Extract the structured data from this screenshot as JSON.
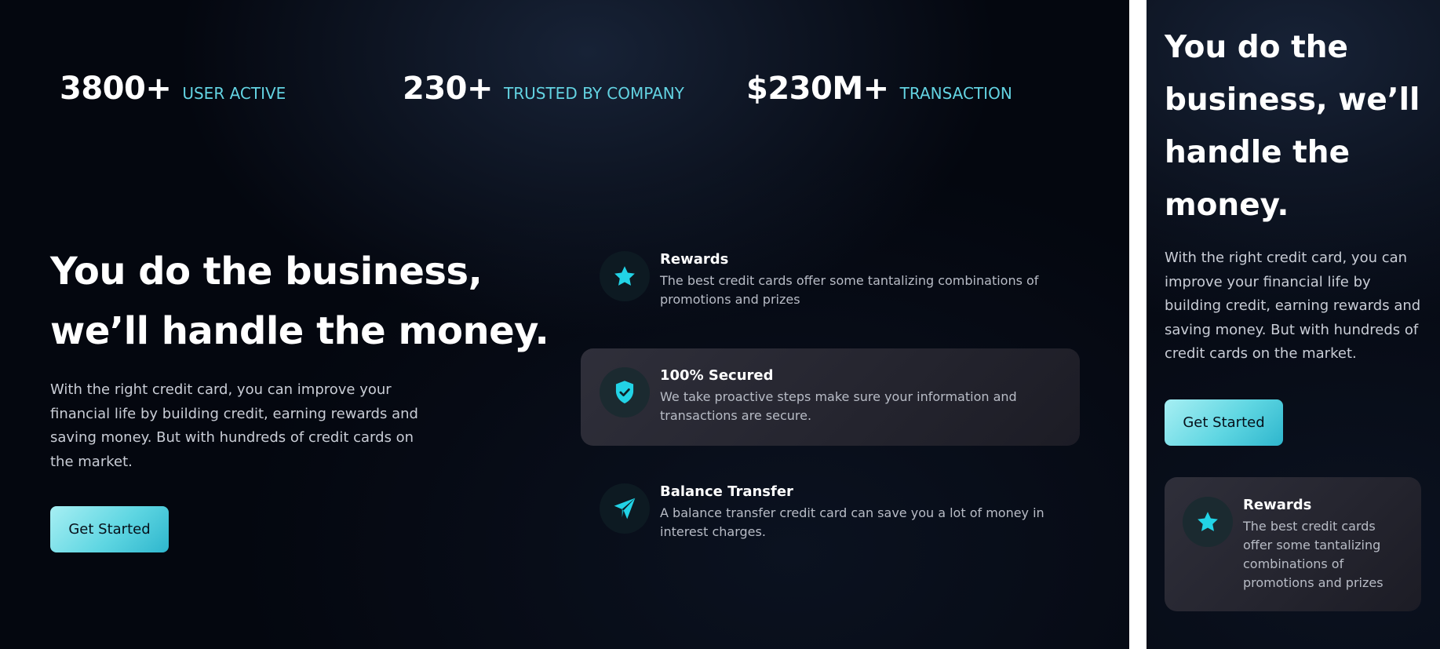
{
  "stats": [
    {
      "value": "3800+",
      "label": "USER ACTIVE"
    },
    {
      "value": "230+",
      "label": "TRUSTED BY COMPANY"
    },
    {
      "value": "$230M+",
      "label": "TRANSACTION"
    }
  ],
  "hero": {
    "title_line1": "You do the business,",
    "title_line2": "we’ll handle the money.",
    "description": "With the right credit card, you can improve your financial life by building credit, earning rewards and saving money. But with hundreds of credit cards on the market.",
    "cta_label": "Get Started"
  },
  "features": [
    {
      "icon": "star-icon",
      "title": "Rewards",
      "text": "The best credit cards offer some tantalizing combinations of promotions and prizes"
    },
    {
      "icon": "shield-check-icon",
      "title": "100% Secured",
      "text": "We take proactive steps make sure your information and transactions are secure."
    },
    {
      "icon": "paper-plane-icon",
      "title": "Balance Transfer",
      "text": "A balance transfer credit card can save you a lot of money in interest charges."
    }
  ],
  "side": {
    "title": "You do the business, we’ll handle the money.",
    "description": "With the right credit card, you can improve your financial life by building credit, earning rewards and saving money. But with hundreds of credit cards on the market.",
    "cta_label": "Get Started",
    "feature": {
      "icon": "star-icon",
      "title": "Rewards",
      "text": "The best credit cards offer some tantalizing combinations of promotions and prizes"
    }
  },
  "colors": {
    "accent": "#22d3e6",
    "stat_label": "#63d3e2",
    "background": "#04070f",
    "card": "#2a2a34"
  }
}
